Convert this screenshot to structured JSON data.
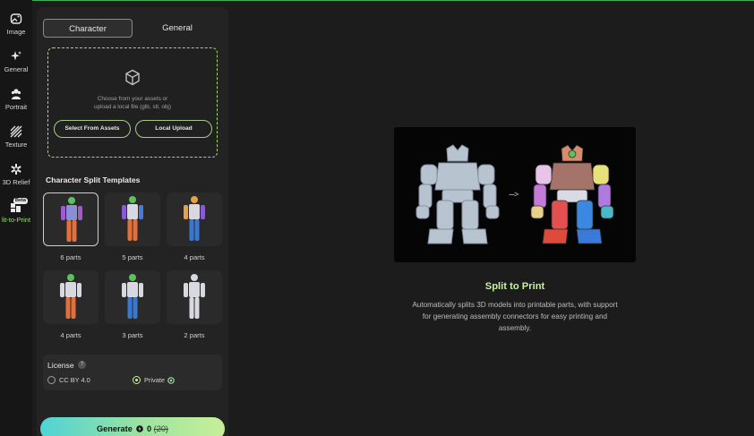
{
  "rail": {
    "items": [
      {
        "label": "Image",
        "icon": "image-icon"
      },
      {
        "label": "General",
        "icon": "sparkle-icon"
      },
      {
        "label": "Portrait",
        "icon": "portrait-icon"
      },
      {
        "label": "Texture",
        "icon": "texture-icon"
      },
      {
        "label": "3D Relief",
        "icon": "relief-icon"
      },
      {
        "label": "lit-to-Print",
        "icon": "split-print-icon",
        "badge": "Beta"
      }
    ]
  },
  "panel": {
    "tabs": [
      {
        "label": "Character",
        "active": true
      },
      {
        "label": "General",
        "active": false
      }
    ],
    "upload": {
      "hint_line1": "Choose from your assets or",
      "hint_line2": "upload a local file (glb, stl, obj)",
      "select_label": "Select From Assets",
      "upload_label": "Local Upload"
    },
    "templates_title": "Character Split Templates",
    "templates": [
      {
        "label": "6 parts",
        "selected": true
      },
      {
        "label": "5 parts",
        "selected": false
      },
      {
        "label": "4 parts",
        "selected": false
      },
      {
        "label": "4 parts",
        "selected": false
      },
      {
        "label": "3 parts",
        "selected": false
      },
      {
        "label": "2 parts",
        "selected": false
      }
    ],
    "license": {
      "title": "License",
      "help": "?",
      "options": [
        {
          "label": "CC BY 4.0",
          "checked": false
        },
        {
          "label": "Private",
          "checked": true
        }
      ]
    },
    "generate": {
      "label": "Generate",
      "cost": "0",
      "original_cost": "(20)"
    }
  },
  "feature": {
    "arrow": "--->",
    "title": "Split to Print",
    "description": "Automatically splits 3D models into printable parts, with support for generating assembly connectors for easy printing and assembly."
  },
  "colors": {
    "accent": "#c6f1a0",
    "panel": "#232323",
    "background": "#1c1c1c"
  }
}
